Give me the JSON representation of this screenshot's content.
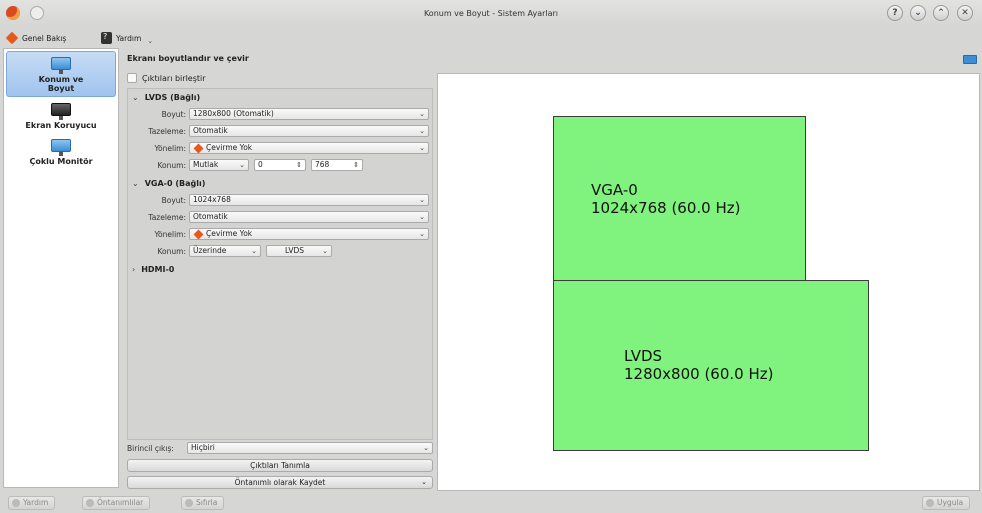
{
  "window": {
    "title": "Konum ve Boyut - Sistem Ayarları",
    "buttons": [
      "?",
      "⌄",
      "⌃",
      "✕"
    ]
  },
  "toolbar": {
    "overview_label": "Genel Bakış",
    "help_label": "Yardım"
  },
  "sidebar": {
    "items": [
      {
        "label_line1": "Konum ve",
        "label_line2": "Boyut",
        "active": true,
        "icon": "monitor-icon"
      },
      {
        "label_line1": "Ekran Koruyucu",
        "label_line2": "",
        "active": false,
        "icon": "screensaver-monitor-icon"
      },
      {
        "label_line1": "Çoklu Monitör",
        "label_line2": "",
        "active": false,
        "icon": "monitor-icon"
      }
    ]
  },
  "main": {
    "title": "Ekranı boyutlandır ve çevir",
    "combine_outputs_label": "Çıktıları birleştir",
    "outputs": {
      "lvds": {
        "header": "LVDS (Bağlı)",
        "arrow": "⌄",
        "size_label": "Boyut:",
        "size_value": "1280x800 (Otomatik)",
        "refresh_label": "Tazeleme:",
        "refresh_value": "Otomatik",
        "orientation_label": "Yönelim:",
        "orientation_value": "Çevirme Yok",
        "position_label": "Konum:",
        "position_mode": "Mutlak",
        "position_x": "0",
        "position_y": "768"
      },
      "vga": {
        "header": "VGA-0 (Bağlı)",
        "arrow": "⌄",
        "size_label": "Boyut:",
        "size_value": "1024x768",
        "refresh_label": "Tazeleme:",
        "refresh_value": "Otomatik",
        "orientation_label": "Yönelim:",
        "orientation_value": "Çevirme Yok",
        "position_label": "Konum:",
        "position_mode": "Üzerinde",
        "position_relative": "LVDS"
      },
      "hdmi": {
        "header": "HDMI-0",
        "arrow": "›"
      }
    },
    "primary_label": "Birincil çıkış:",
    "primary_value": "Hiçbiri",
    "identify_button": "Çıktıları Tanımla",
    "save_default_button": "Öntanımlı olarak Kaydet"
  },
  "preview": {
    "screens": [
      {
        "name": "VGA-0",
        "mode": "1024x768 (60.0 Hz)"
      },
      {
        "name": "LVDS",
        "mode": "1280x800 (60.0 Hz)"
      }
    ]
  },
  "footer": {
    "help": "Yardım",
    "defaults": "Öntanımlılar",
    "reset": "Sıfırla",
    "apply": "Uygula"
  },
  "colors": {
    "screen_fill": "#80f27e",
    "selection": "#9fc3ee",
    "accent_orange": "#e25a1c"
  }
}
